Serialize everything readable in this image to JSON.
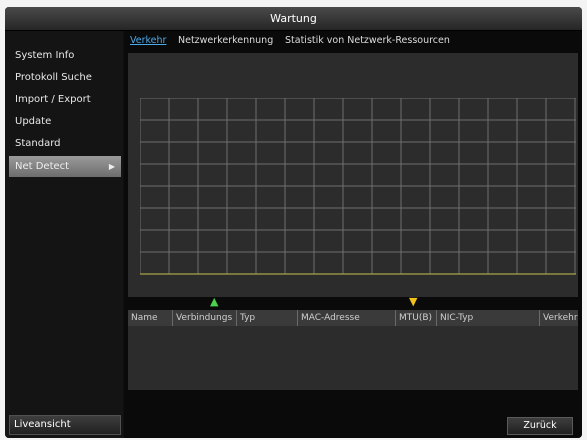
{
  "window": {
    "title": "Wartung"
  },
  "sidebar": {
    "items": [
      {
        "label": "System Info"
      },
      {
        "label": "Protokoll Suche"
      },
      {
        "label": "Import / Export"
      },
      {
        "label": "Update"
      },
      {
        "label": "Standard"
      },
      {
        "label": "Net Detect",
        "active": true,
        "chevron": "chevron-right-icon"
      }
    ],
    "live_button": "Liveansicht"
  },
  "tabs": [
    {
      "label": "Verkehr",
      "active": true
    },
    {
      "label": "Netzwerkerkennung"
    },
    {
      "label": "Statistik von Netzwerk-Ressourcen"
    }
  ],
  "traffic": {
    "upload_icon": "arrow-up-icon",
    "download_icon": "arrow-down-icon",
    "upload_color": "#4cd24c",
    "download_color": "#f2c21c"
  },
  "table": {
    "columns": [
      "Name",
      "Verbindungs",
      "Typ",
      "MAC-Adresse",
      "MTU(B)",
      "NIC-Typ",
      "Verkehr"
    ]
  },
  "footer": {
    "back_button": "Zurück"
  }
}
